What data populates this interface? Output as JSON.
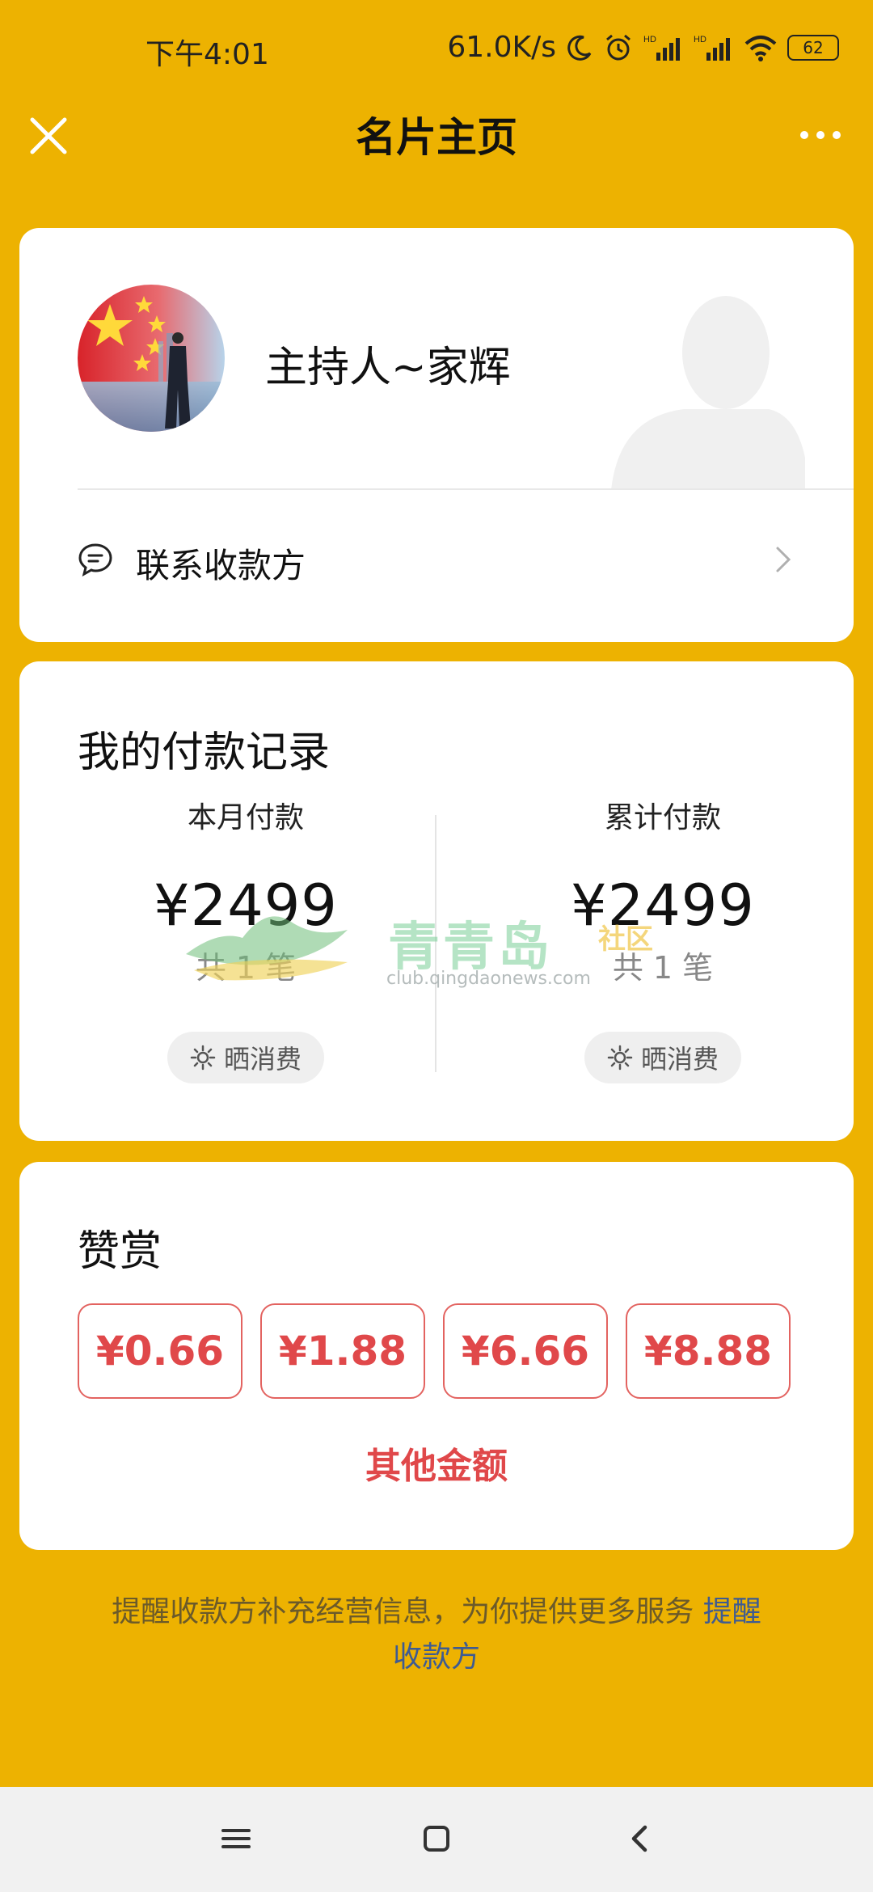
{
  "status_bar": {
    "time": "下午4:01",
    "speed": "61.0K/s",
    "battery": "62"
  },
  "header": {
    "title": "名片主页"
  },
  "profile": {
    "name": "主持人~家辉",
    "contact_label": "联系收款方"
  },
  "payment_records": {
    "title": "我的付款记录",
    "monthly": {
      "label": "本月付款",
      "amount": "¥2499",
      "count": "共 1 笔",
      "share_label": "晒消费"
    },
    "total": {
      "label": "累计付款",
      "amount": "¥2499",
      "count": "共 1 笔",
      "share_label": "晒消费"
    }
  },
  "reward": {
    "title": "赞赏",
    "amounts": [
      "¥0.66",
      "¥1.88",
      "¥6.66",
      "¥8.88"
    ],
    "other_label": "其他金额"
  },
  "reminder": {
    "text": "提醒收款方补充经营信息，为你提供更多服务 ",
    "link": "提醒收款方"
  },
  "watermark": {
    "name": "青青岛",
    "sub": "社区",
    "url": "club.qingdaonews.com"
  },
  "colors": {
    "background": "#EDB201",
    "accent_red": "#E0484A",
    "link_blue": "#3E5B92"
  }
}
